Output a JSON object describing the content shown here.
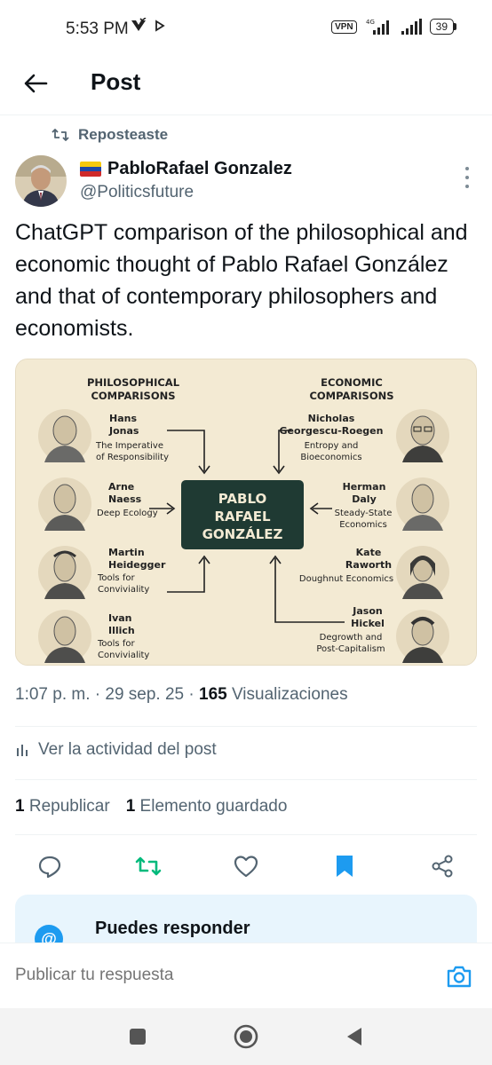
{
  "status_bar": {
    "time": "5:53 PM",
    "vpn": "VPN",
    "network": "4G",
    "battery": "39"
  },
  "header": {
    "title": "Post"
  },
  "repost": {
    "label": "Reposteaste"
  },
  "post": {
    "author_name": "PabloRafael Gonzalez",
    "author_handle": "@Politicsfuture",
    "text": "ChatGPT comparison of the philosophical and economic thought of Pablo Rafael González and that of contemporary philosophers and economists.",
    "timestamp": "1:07 p. m. · 29 sep. 25 · ",
    "views_count": "165",
    "views_label": " Visualizaciones"
  },
  "infographic": {
    "left_heading": [
      "PHILOSOPHICAL",
      "COMPARISONS"
    ],
    "right_heading": [
      "ECONOMIC",
      "COMPARISONS"
    ],
    "center": [
      "PABLO",
      "RAFAEL",
      "GONZÁLEZ"
    ],
    "left_items": [
      {
        "name": [
          "Hans",
          "Jonas"
        ],
        "desc": [
          "The Imperative",
          "of Responsibility"
        ]
      },
      {
        "name": [
          "Arne",
          "Naess"
        ],
        "desc": [
          "Deep Ecology"
        ]
      },
      {
        "name": [
          "Martin",
          "Heidegger"
        ],
        "desc": [
          "Tools for",
          "Conviviality"
        ]
      },
      {
        "name": [
          "Ivan",
          "Illich"
        ],
        "desc": [
          "Tools for",
          "Conviviality"
        ]
      }
    ],
    "right_items": [
      {
        "name": [
          "Nicholas",
          "Georgescu-Roegen"
        ],
        "desc": [
          "Entropy and",
          "Bioeconomics"
        ]
      },
      {
        "name": [
          "Herman",
          "Daly"
        ],
        "desc": [
          "Steady-State",
          "Economics"
        ]
      },
      {
        "name": [
          "Kate",
          "Raworth"
        ],
        "desc": [
          "Doughnut Economics"
        ]
      },
      {
        "name": [
          "Jason",
          "Hickel"
        ],
        "desc": [
          "Degrowth and",
          "Post-Capitalism"
        ]
      }
    ]
  },
  "activity": {
    "label": "Ver la actividad del post"
  },
  "stats": {
    "reposts_count": "1",
    "reposts_label": "Republicar",
    "bookmarks_count": "1",
    "bookmarks_label": "Elemento guardado"
  },
  "reply_card": {
    "title": "Puedes responder",
    "icon_glyph": "@"
  },
  "composer": {
    "placeholder": "Publicar tu respuesta"
  },
  "colors": {
    "accent": "#1d9bf0",
    "repost_active": "#00ba7c",
    "bookmark_active": "#1d9bf0",
    "center_box": "#1f3a33"
  },
  "icons": [
    "back-arrow-icon",
    "repost-icon",
    "more-icon",
    "analytics-icon",
    "reply-icon",
    "like-icon",
    "bookmark-icon",
    "share-icon",
    "camera-icon",
    "at-icon",
    "nav-recents-icon",
    "nav-home-icon",
    "nav-back-icon"
  ]
}
